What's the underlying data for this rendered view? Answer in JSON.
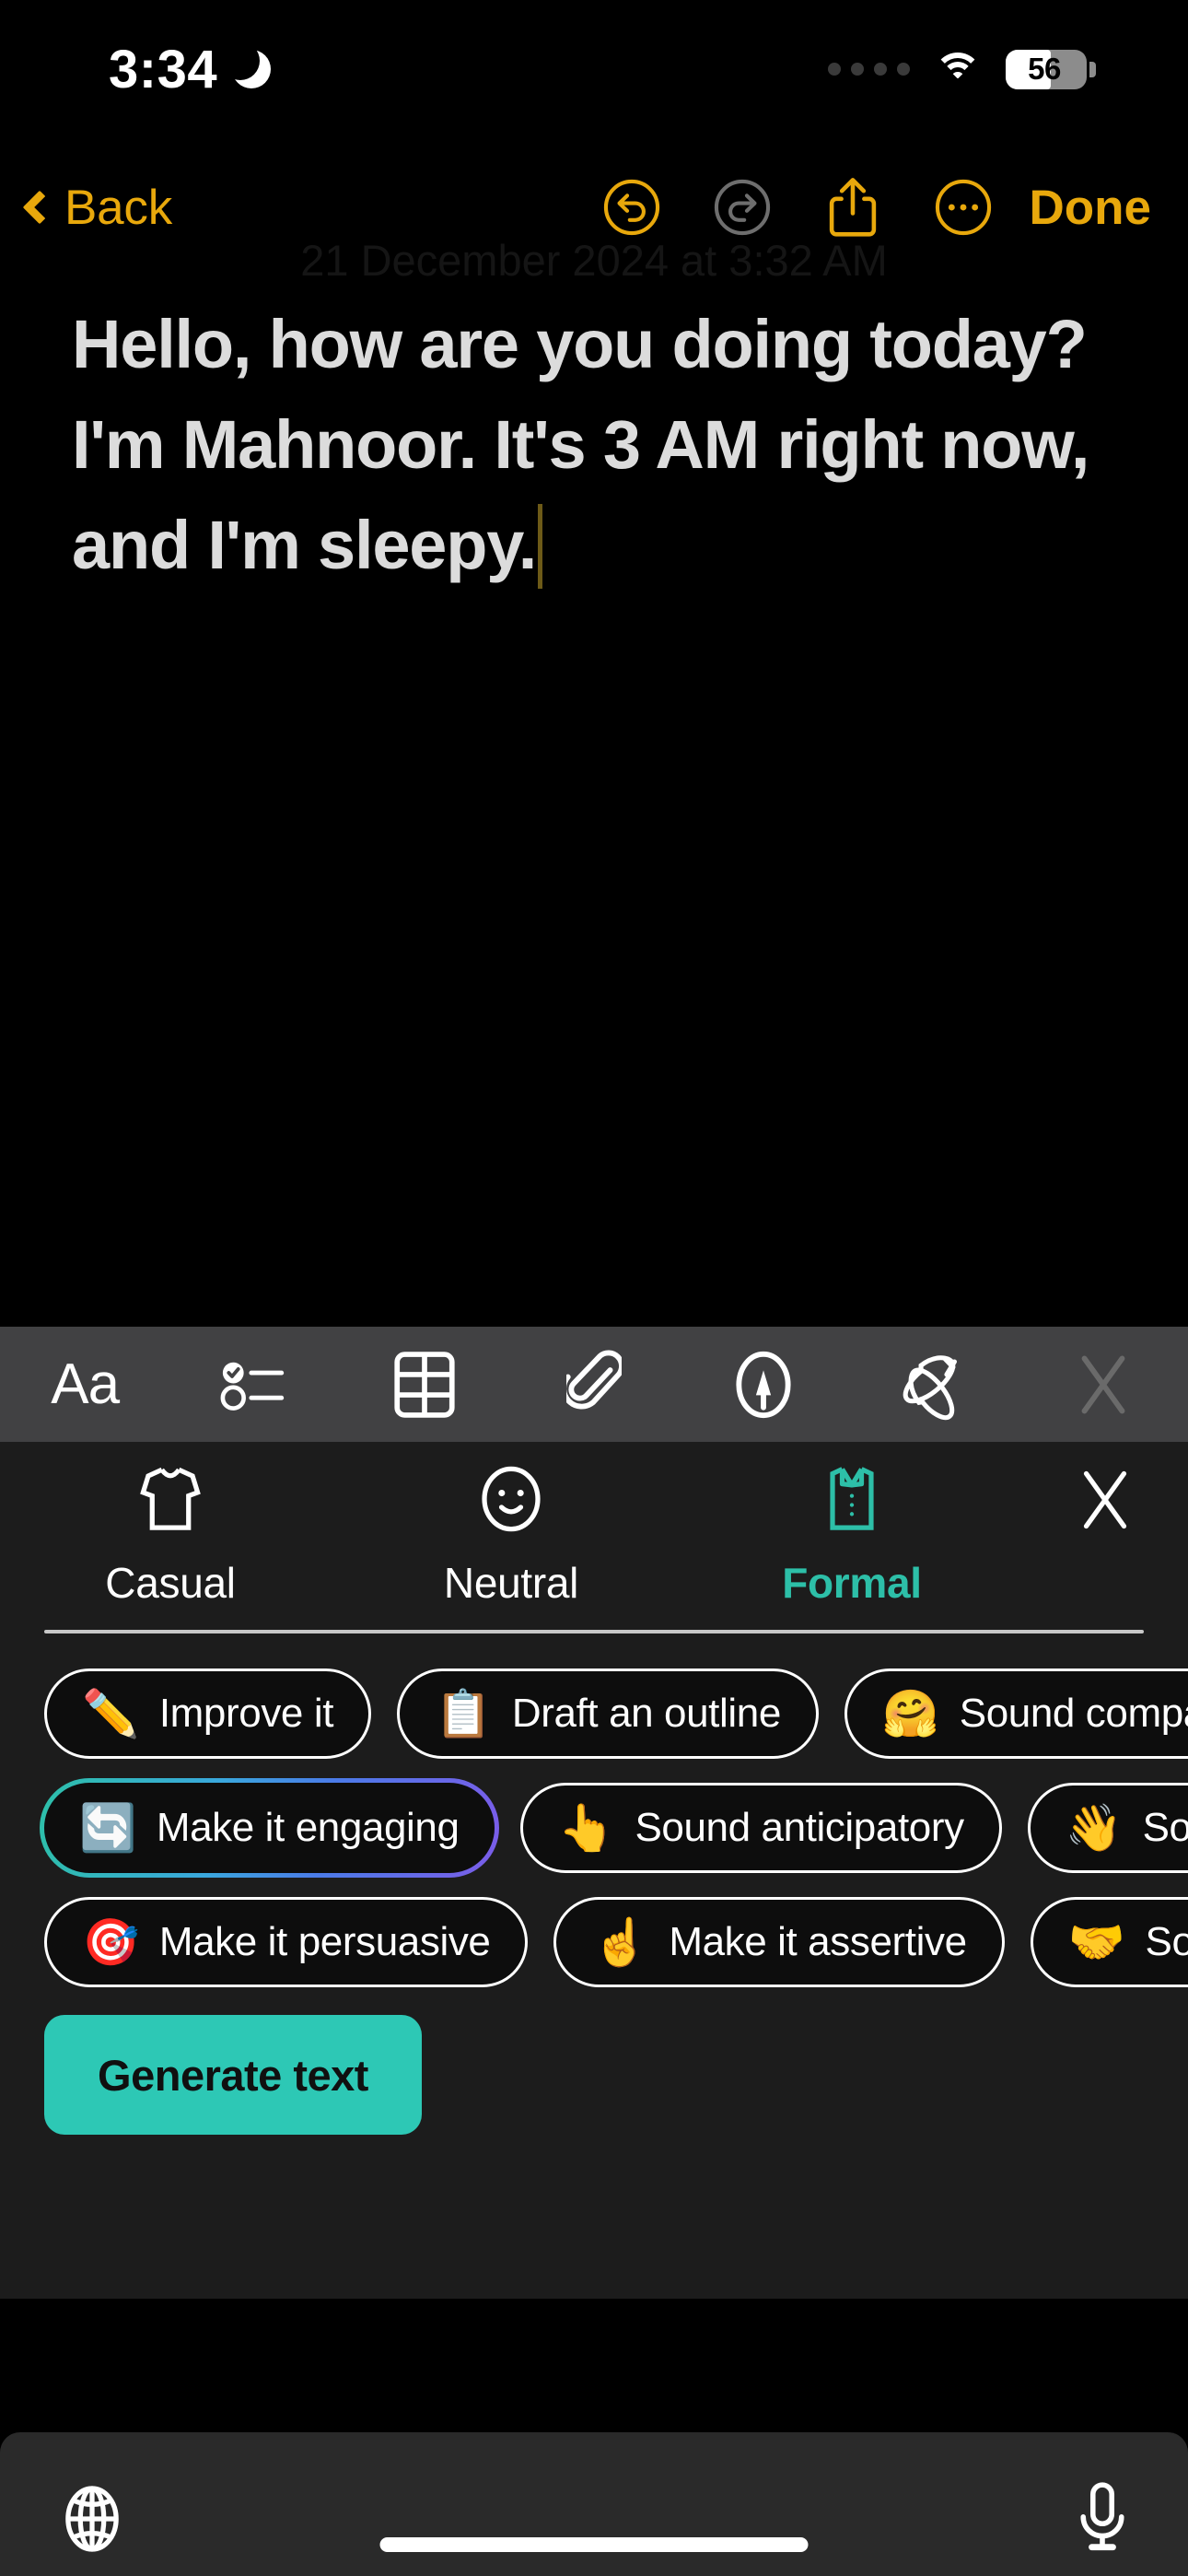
{
  "status_bar": {
    "time": "3:34",
    "dnd_icon": "crescent-moon-icon",
    "signal_dots": 4,
    "wifi_icon": "wifi-icon",
    "battery_percent": "56",
    "battery_level": 56
  },
  "nav_bar": {
    "back_label": "Back",
    "done_label": "Done",
    "undo_icon": "undo-circle-icon",
    "redo_icon": "redo-circle-icon",
    "share_icon": "share-icon",
    "more_icon": "more-ellipsis-icon",
    "undo_enabled": true,
    "redo_enabled": false,
    "accent_color": "#E8A80C"
  },
  "note": {
    "timestamp": "21 December 2024 at 3:32 AM",
    "body": "Hello, how are you doing today? I'm Mahnoor. It's 3 AM right now, and I'm sleepy.",
    "caret_color": "#6d5a17",
    "text_color": "#DCDCDC"
  },
  "format_toolbar": {
    "background": "#414143",
    "items": [
      {
        "name": "text-format-icon",
        "label": "Aa"
      },
      {
        "name": "checklist-icon",
        "label": ""
      },
      {
        "name": "table-icon",
        "label": ""
      },
      {
        "name": "attachment-paperclip-icon",
        "label": ""
      },
      {
        "name": "markup-pen-icon",
        "label": ""
      },
      {
        "name": "apple-intelligence-icon",
        "label": ""
      },
      {
        "name": "close-icon",
        "label": ""
      }
    ]
  },
  "ai_panel": {
    "background": "#1C1C1C",
    "accent_color": "#2DBFA8",
    "close_icon": "close-icon",
    "tones": [
      {
        "label": "Casual",
        "icon": "tshirt-icon",
        "selected": false
      },
      {
        "label": "Neutral",
        "icon": "smiley-face-icon",
        "selected": false
      },
      {
        "label": "Formal",
        "icon": "dress-shirt-icon",
        "selected": true
      }
    ],
    "suggestion_rows": [
      [
        {
          "emoji": "✏️",
          "label": "Improve it",
          "highlighted": false
        },
        {
          "emoji": "📋",
          "label": "Draft an outline",
          "highlighted": false
        },
        {
          "emoji": "🤗",
          "label": "Sound compassionate",
          "highlighted": false
        }
      ],
      [
        {
          "emoji": "🔄",
          "label": "Make it engaging",
          "highlighted": true
        },
        {
          "emoji": "👆",
          "label": "Sound anticipatory",
          "highlighted": false
        },
        {
          "emoji": "👋",
          "label": "Sound welcoming",
          "highlighted": false
        }
      ],
      [
        {
          "emoji": "🎯",
          "label": "Make it persuasive",
          "highlighted": false
        },
        {
          "emoji": "☝️",
          "label": "Make it assertive",
          "highlighted": false
        },
        {
          "emoji": "🤝",
          "label": "Sound supportive",
          "highlighted": false
        }
      ]
    ],
    "generate_label": "Generate text",
    "generate_color": "#2DC8B5"
  },
  "keyboard_bar": {
    "globe_icon": "globe-icon",
    "mic_icon": "microphone-icon",
    "background": "#2A2A2A"
  }
}
